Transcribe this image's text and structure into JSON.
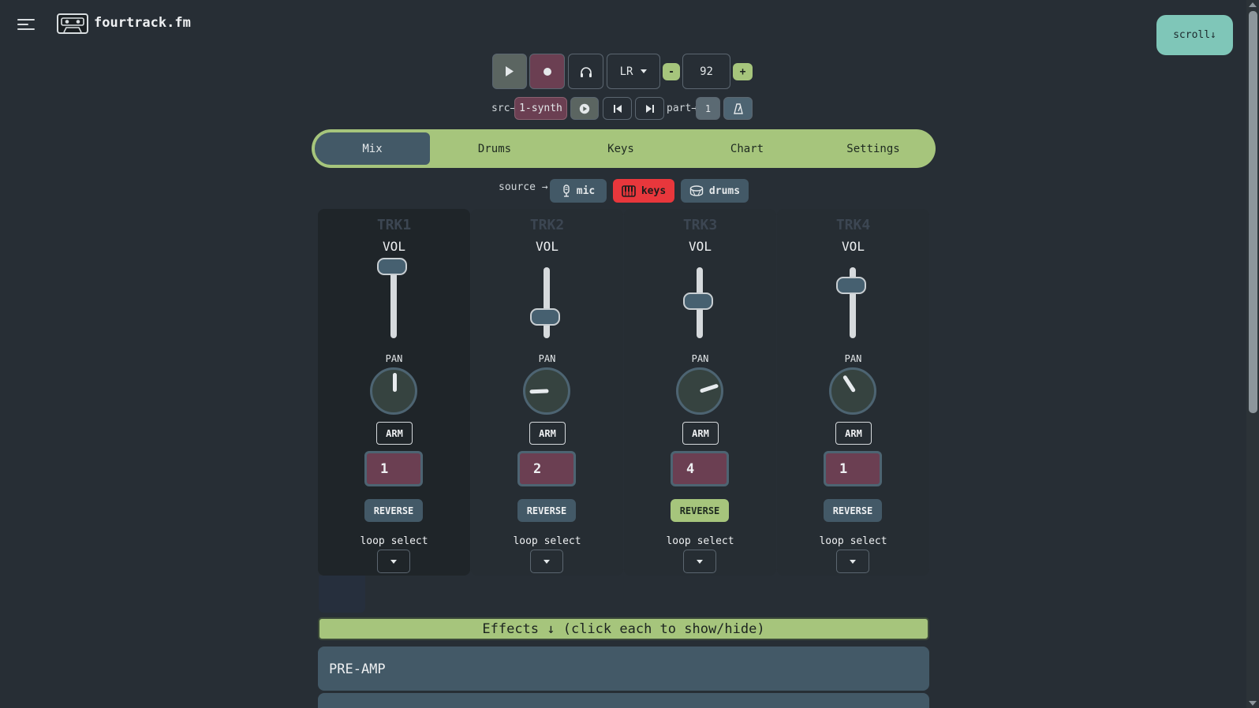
{
  "header": {
    "brand": "fourtrack.fm",
    "scroll_label": "scroll↓"
  },
  "transport": {
    "output": "LR",
    "minus_label": "-",
    "tempo": "92",
    "plus_label": "+",
    "src_label": "src→",
    "src_value": "1-synth",
    "part_label": "part→",
    "part_value": "1"
  },
  "tabs": [
    "Mix",
    "Drums",
    "Keys",
    "Chart",
    "Settings"
  ],
  "active_tab": "Mix",
  "source": {
    "label": "source →",
    "options": [
      {
        "label": "mic",
        "icon": "microphone-icon",
        "active": false
      },
      {
        "label": "keys",
        "icon": "piano-icon",
        "active": true
      },
      {
        "label": "drums",
        "icon": "drum-icon",
        "active": false
      }
    ]
  },
  "tracks": [
    {
      "name": "TRK1",
      "vol_label": "VOL",
      "vol_level": 1.0,
      "pan_label": "PAN",
      "pan_angle_deg": 0,
      "arm_label": "ARM",
      "loop": "1",
      "reverse_label": "REVERSE",
      "reverse_on": false,
      "loop_select_label": "loop select"
    },
    {
      "name": "TRK2",
      "vol_label": "VOL",
      "vol_level": 0.2,
      "pan_label": "PAN",
      "pan_angle_deg": -92,
      "arm_label": "ARM",
      "loop": "2",
      "reverse_label": "REVERSE",
      "reverse_on": false,
      "loop_select_label": "loop select"
    },
    {
      "name": "TRK3",
      "vol_label": "VOL",
      "vol_level": 0.45,
      "pan_label": "PAN",
      "pan_angle_deg": 72,
      "arm_label": "ARM",
      "loop": "4",
      "reverse_label": "REVERSE",
      "reverse_on": true,
      "loop_select_label": "loop select"
    },
    {
      "name": "TRK4",
      "vol_label": "VOL",
      "vol_level": 0.7,
      "pan_label": "PAN",
      "pan_angle_deg": -33,
      "arm_label": "ARM",
      "loop": "1",
      "reverse_label": "REVERSE",
      "reverse_on": false,
      "loop_select_label": "loop select"
    }
  ],
  "effects": {
    "bar_label": "Effects ↓ (click each to show/hide)",
    "panels": [
      "PRE-AMP"
    ]
  },
  "colors": {
    "background": "#272e35",
    "accent_green": "#a6c57c",
    "accent_teal": "#7fc6b8",
    "slate": "#435967",
    "plum": "#6b3f52",
    "keys_red": "#e8373c"
  }
}
